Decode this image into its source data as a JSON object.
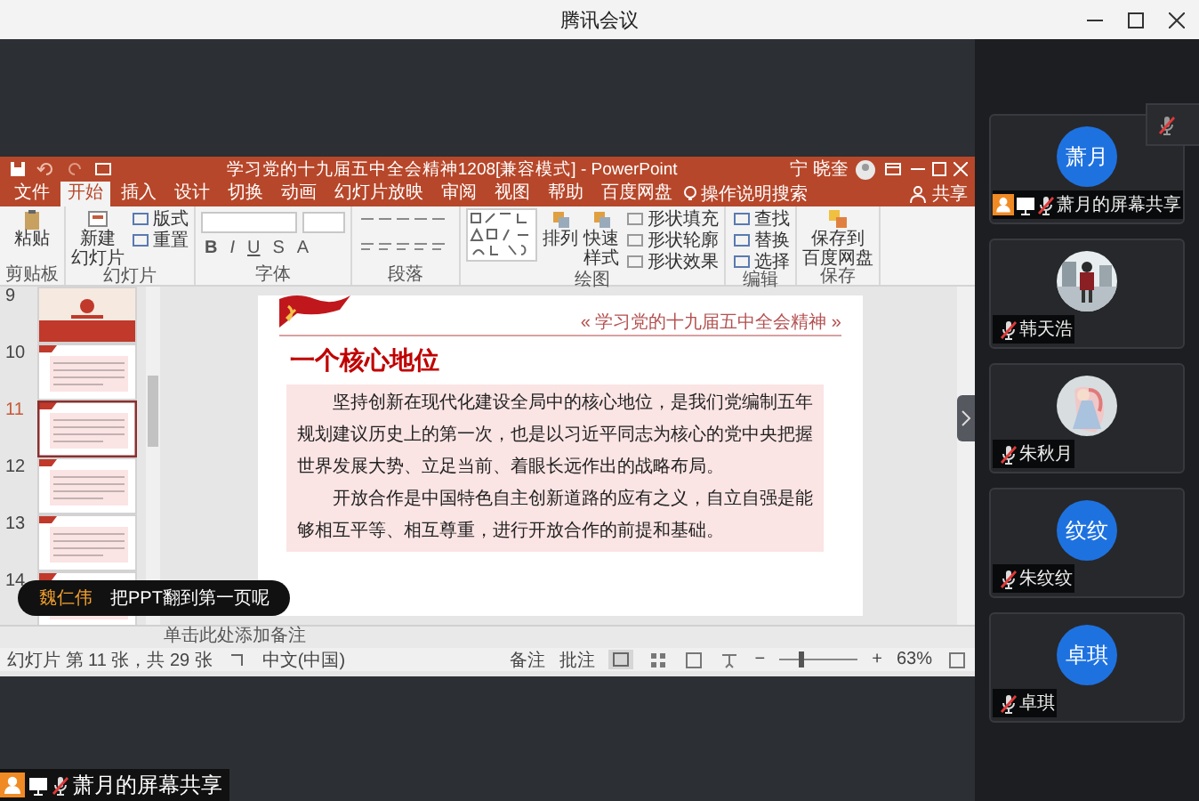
{
  "window": {
    "title": "腾讯会议"
  },
  "ppt": {
    "title": "学习党的十九届五中全会精神1208[兼容模式] - PowerPoint",
    "user": "宁 晓奎",
    "tabs": [
      {
        "label": "文件",
        "selected": false
      },
      {
        "label": "开始",
        "selected": true
      },
      {
        "label": "插入",
        "selected": false
      },
      {
        "label": "设计",
        "selected": false
      },
      {
        "label": "切换",
        "selected": false
      },
      {
        "label": "动画",
        "selected": false
      },
      {
        "label": "幻灯片放映",
        "selected": false
      },
      {
        "label": "审阅",
        "selected": false
      },
      {
        "label": "视图",
        "selected": false
      },
      {
        "label": "帮助",
        "selected": false
      },
      {
        "label": "百度网盘",
        "selected": false
      }
    ],
    "search": "操作说明搜索",
    "share": "共享",
    "ribbon_groups": [
      {
        "label": "剪贴板",
        "kind": "buttons",
        "buttons": [
          {
            "label": "粘贴",
            "kind": "large"
          }
        ]
      },
      {
        "label": "幻灯片",
        "kind": "buttons",
        "buttons": [
          {
            "lines": [
              "新建",
              "幻灯片"
            ],
            "kind": "large"
          },
          {
            "label": "版式",
            "kind": "small"
          },
          {
            "label": "重置",
            "kind": "small"
          }
        ]
      },
      {
        "label": "字体",
        "kind": "font",
        "buttons": [
          {
            "label": "B",
            "kind": "format"
          },
          {
            "label": "I",
            "kind": "format"
          },
          {
            "label": "U",
            "kind": "format"
          },
          {
            "label": "S",
            "kind": "format"
          },
          {
            "label": "A",
            "kind": "format"
          }
        ]
      },
      {
        "label": "段落",
        "kind": "paragraph"
      },
      {
        "label": "绘图",
        "kind": "shapes",
        "buttons": [
          {
            "label": "排列",
            "kind": "large"
          },
          {
            "lines": [
              "快速",
              "样式"
            ],
            "kind": "large"
          },
          {
            "label": "形状填充",
            "kind": "small"
          },
          {
            "label": "形状轮廓",
            "kind": "small"
          },
          {
            "label": "形状效果",
            "kind": "small"
          }
        ]
      },
      {
        "label": "编辑",
        "kind": "buttons",
        "buttons": [
          {
            "label": "查找",
            "kind": "small"
          },
          {
            "label": "替换",
            "kind": "small"
          },
          {
            "label": "选择",
            "kind": "small"
          }
        ]
      },
      {
        "label": "保存",
        "kind": "buttons",
        "buttons": [
          {
            "lines": [
              "保存到",
              "百度网盘"
            ],
            "kind": "large"
          }
        ]
      }
    ],
    "thumbnails": [
      {
        "number": "9",
        "kind": "cover",
        "selected": false
      },
      {
        "number": "10",
        "kind": "text",
        "selected": false
      },
      {
        "number": "11",
        "kind": "text",
        "selected": true
      },
      {
        "number": "12",
        "kind": "text",
        "selected": false
      },
      {
        "number": "13",
        "kind": "text",
        "selected": false
      },
      {
        "number": "14",
        "kind": "text",
        "selected": false
      }
    ],
    "slide": {
      "header": "« 学习党的十九届五中全会精神 »",
      "heading": "一个核心地位",
      "paragraphs": [
        "坚持创新在现代化建设全局中的核心地位，是我们党编制五年规划建议历史上的第一次，也是以习近平同志为核心的党中央把握世界发展大势、立足当前、着眼长远作出的战略布局。",
        "开放合作是中国特色自主创新道路的应有之义，自立自强是能够相互平等、相互尊重，进行开放合作的前提和基础。"
      ]
    },
    "notes_placeholder": "单击此处添加备注",
    "status": {
      "slide_info": "幻灯片 第 11 张，共 29 张",
      "language": "中文(中国)",
      "notes": "备注",
      "comments": "批注",
      "zoom_out": "−",
      "zoom_in": "+",
      "zoom_slider": {
        "level": 0.27
      },
      "zoom": "63%"
    }
  },
  "toast": {
    "sender": "魏仁伟",
    "message": "把PPT翻到第一页呢"
  },
  "share_label": {
    "name": "萧月的屏幕共享",
    "muted": true
  },
  "participants": [
    {
      "name": "萧月的屏幕共享",
      "kind": "initials",
      "initials": "萧月",
      "sharing": true,
      "muted": true
    },
    {
      "name": "韩天浩",
      "kind": "picture",
      "sharing": false,
      "muted": true
    },
    {
      "name": "朱秋月",
      "kind": "picture",
      "sharing": false,
      "muted": true
    },
    {
      "name": "朱纹纹",
      "kind": "initials",
      "initials": "纹纹",
      "sharing": false,
      "muted": true
    },
    {
      "name": "卓琪",
      "kind": "initials",
      "initials": "卓琪",
      "sharing": false,
      "muted": true
    }
  ]
}
